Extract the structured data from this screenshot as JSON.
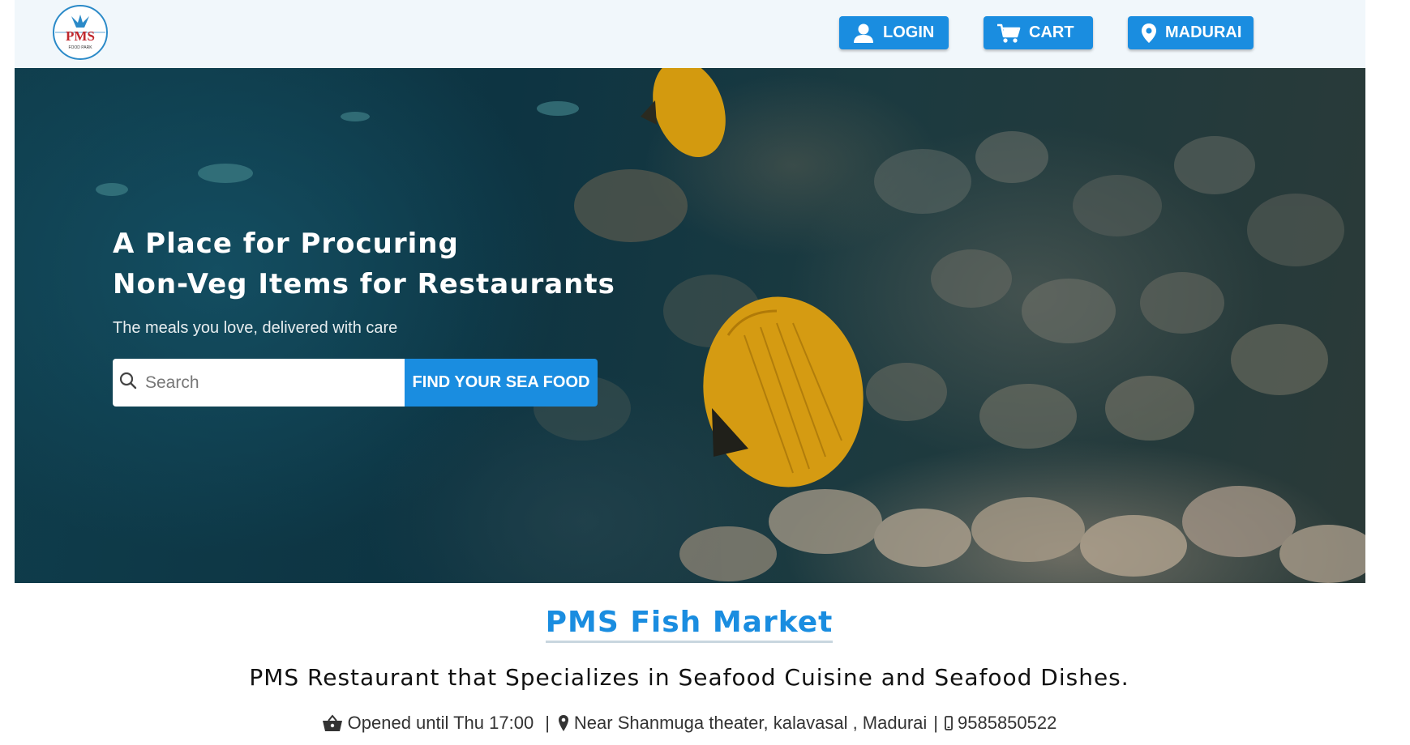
{
  "header": {
    "logo": {
      "text": "PMS",
      "subtext": "FOOD PARK"
    },
    "login_label": "LOGIN",
    "cart_label": "CART",
    "city_label": "MADURAI"
  },
  "hero": {
    "title_line1": "A Place for Procuring",
    "title_line2": "Non-Veg Items for Restaurants",
    "subtitle": "The meals you love, delivered with care",
    "search": {
      "placeholder": "Search",
      "value": ""
    },
    "find_button_label": "FIND YOUR SEA FOOD"
  },
  "info": {
    "market_title": "PMS Fish Market",
    "tagline": "PMS Restaurant that Specializes in Seafood Cuisine and Seafood Dishes.",
    "hours": "Opened until Thu 17:00",
    "sep1": "|",
    "address": "Near Shanmuga theater, kalavasal , Madurai",
    "sep2": "|",
    "phone": "9585850522"
  },
  "colors": {
    "accent": "#1a8de0",
    "header_bg": "#f1f7fb",
    "text_dark": "#111111"
  },
  "icons": {
    "login": "user-icon",
    "cart": "cart-icon",
    "city": "location-pin-icon",
    "search": "search-icon",
    "hours": "basket-icon",
    "address": "location-pin-icon",
    "phone": "mobile-phone-icon"
  }
}
